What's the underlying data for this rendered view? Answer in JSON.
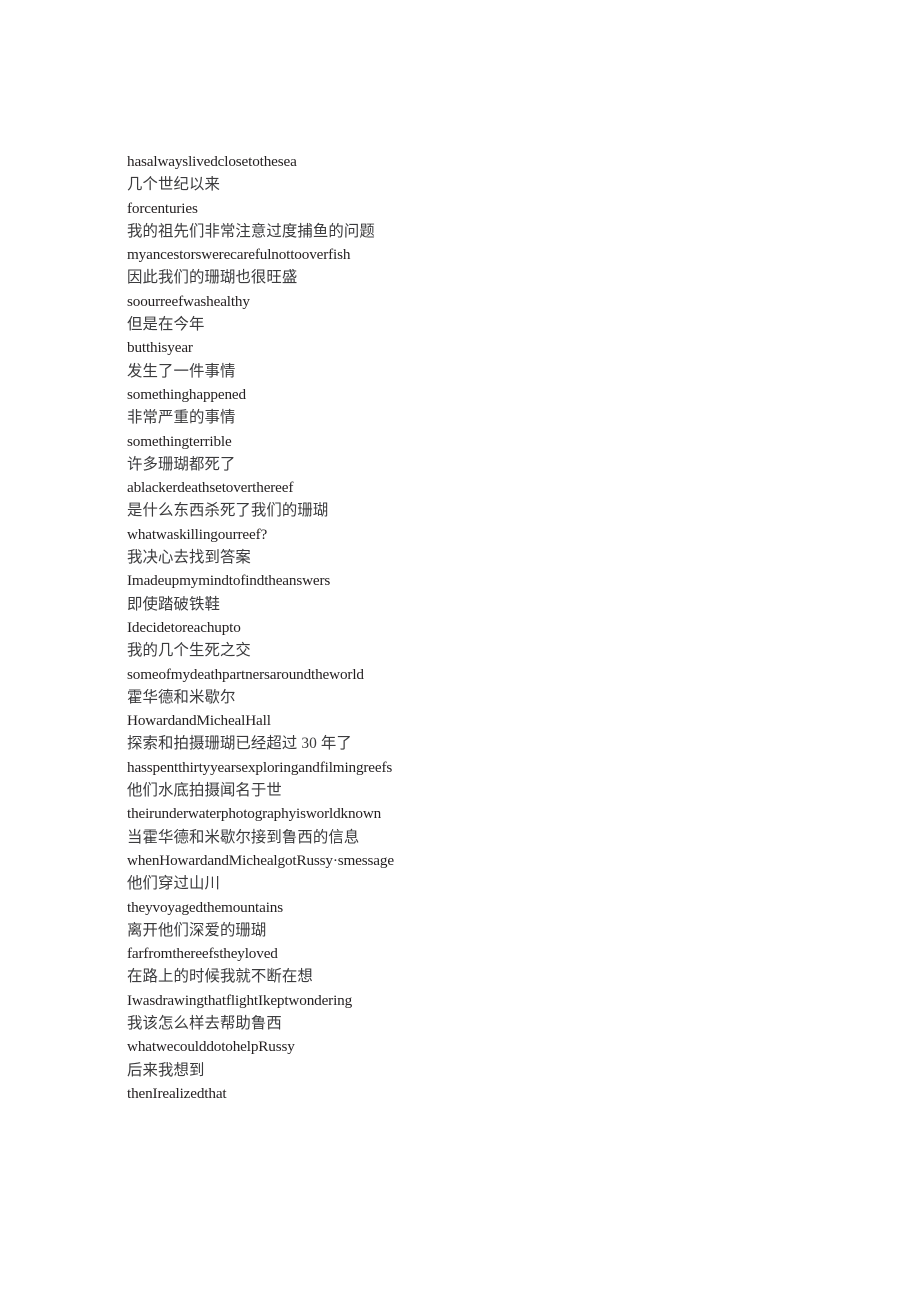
{
  "document": {
    "type": "bilingual-subtitle-transcript",
    "page_background": "#ffffff",
    "english_text_color": "#231f20",
    "chinese_text_color": "#3b3b3d",
    "line_count": 41,
    "lines": [
      {
        "lang": "en",
        "text": "hasalwayslivedclosetothesea"
      },
      {
        "lang": "zh",
        "text": "几个世纪以来"
      },
      {
        "lang": "en",
        "text": "forcenturies"
      },
      {
        "lang": "zh",
        "text": "我的祖先们非常注意过度捕鱼的问题"
      },
      {
        "lang": "en",
        "text": "myancestorswerecarefulnottooverfish"
      },
      {
        "lang": "zh",
        "text": "因此我们的珊瑚也很旺盛"
      },
      {
        "lang": "en",
        "text": "soourreefwashealthy"
      },
      {
        "lang": "zh",
        "text": "但是在今年"
      },
      {
        "lang": "en",
        "text": "butthisyear"
      },
      {
        "lang": "zh",
        "text": "发生了一件事情"
      },
      {
        "lang": "en",
        "text": "somethinghappened"
      },
      {
        "lang": "zh",
        "text": "非常严重的事情"
      },
      {
        "lang": "en",
        "text": "somethingterrible"
      },
      {
        "lang": "zh",
        "text": "许多珊瑚都死了"
      },
      {
        "lang": "en",
        "text": "ablackerdeathsetoverthereef"
      },
      {
        "lang": "zh",
        "text": "是什么东西杀死了我们的珊瑚"
      },
      {
        "lang": "en",
        "text": "whatwaskillingourreef?"
      },
      {
        "lang": "zh",
        "text": "我决心去找到答案"
      },
      {
        "lang": "en",
        "text": "Imadeupmymindtofindtheanswers"
      },
      {
        "lang": "zh",
        "text": "即使踏破铁鞋"
      },
      {
        "lang": "en",
        "text": "Idecidetoreachupto"
      },
      {
        "lang": "zh",
        "text": "我的几个生死之交"
      },
      {
        "lang": "en",
        "text": "someofmydeathpartnersaroundtheworld"
      },
      {
        "lang": "zh",
        "text": "霍华德和米歇尔"
      },
      {
        "lang": "en",
        "text": "HowardandMichealHall"
      },
      {
        "lang": "zh",
        "text": "探索和拍摄珊瑚已经超过 30 年了"
      },
      {
        "lang": "en",
        "text": "hasspentthirtyyearsexploringandfilmingreefs"
      },
      {
        "lang": "zh",
        "text": "他们水底拍摄闻名于世"
      },
      {
        "lang": "en",
        "text": "theirunderwaterphotographyisworldknown"
      },
      {
        "lang": "zh",
        "text": "当霍华德和米歇尔接到鲁西的信息"
      },
      {
        "lang": "en",
        "text": "whenHowardandMichealgotRussy·smessage"
      },
      {
        "lang": "zh",
        "text": "他们穿过山川"
      },
      {
        "lang": "en",
        "text": "theyvoyagedthemountains"
      },
      {
        "lang": "zh",
        "text": "离开他们深爱的珊瑚"
      },
      {
        "lang": "en",
        "text": "farfromthereefstheyloved"
      },
      {
        "lang": "zh",
        "text": "在路上的时候我就不断在想"
      },
      {
        "lang": "en",
        "text": "IwasdrawingthatflightIkeptwondering"
      },
      {
        "lang": "zh",
        "text": "我该怎么样去帮助鲁西"
      },
      {
        "lang": "en",
        "text": "whatwecoulddotohelpRussy"
      },
      {
        "lang": "zh",
        "text": "后来我想到"
      },
      {
        "lang": "en",
        "text": "thenIrealizedthat"
      }
    ]
  }
}
